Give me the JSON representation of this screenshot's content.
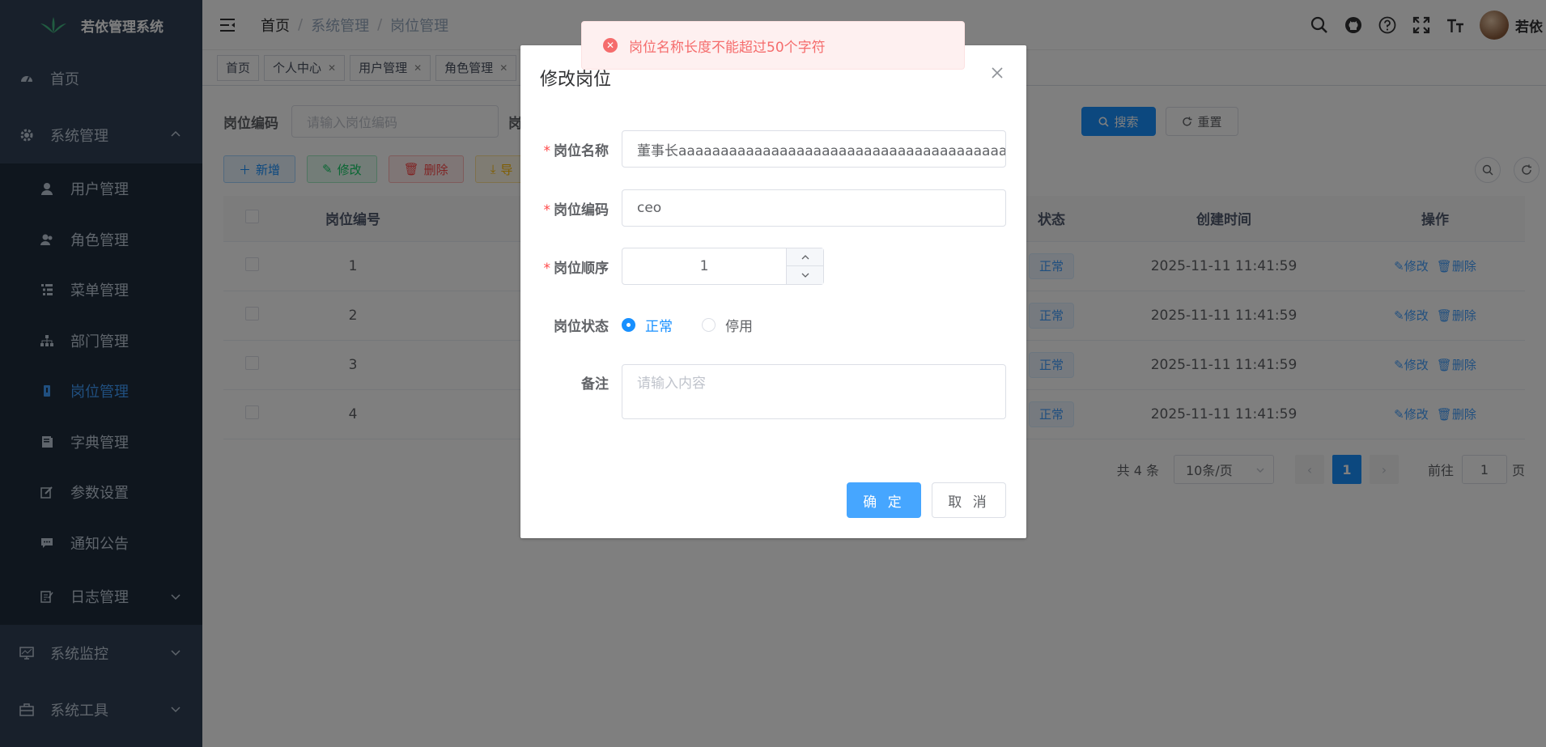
{
  "app": {
    "title": "若依管理系统"
  },
  "sidebar": {
    "items": [
      {
        "label": "首页",
        "icon": "dashboard-icon"
      },
      {
        "label": "系统管理",
        "icon": "gear-icon",
        "expanded": true
      }
    ],
    "submenu": [
      {
        "label": "用户管理",
        "icon": "user-icon"
      },
      {
        "label": "角色管理",
        "icon": "peoples-icon"
      },
      {
        "label": "菜单管理",
        "icon": "tree-table-icon"
      },
      {
        "label": "部门管理",
        "icon": "tree-icon"
      },
      {
        "label": "岗位管理",
        "icon": "post-icon",
        "active": true
      },
      {
        "label": "字典管理",
        "icon": "dict-icon"
      },
      {
        "label": "参数设置",
        "icon": "edit-icon"
      },
      {
        "label": "通知公告",
        "icon": "message-icon"
      },
      {
        "label": "日志管理",
        "icon": "log-icon"
      }
    ],
    "bottom": [
      {
        "label": "系统监控",
        "icon": "monitor-icon"
      },
      {
        "label": "系统工具",
        "icon": "tool-icon"
      }
    ]
  },
  "navbar": {
    "breadcrumb": [
      "首页",
      "系统管理",
      "岗位管理"
    ],
    "user_name": "若依"
  },
  "tags": [
    {
      "label": "首页",
      "closable": false
    },
    {
      "label": "个人中心",
      "closable": true
    },
    {
      "label": "用户管理",
      "closable": true
    },
    {
      "label": "角色管理",
      "closable": true
    }
  ],
  "search": {
    "code_label": "岗位编码",
    "code_placeholder": "请输入岗位编码",
    "name_label_partial": "岗",
    "search_btn": "搜索",
    "reset_btn": "重置"
  },
  "toolbar": {
    "add": "新增",
    "edit": "修改",
    "delete": "删除",
    "export_partial": "导"
  },
  "table": {
    "headers": {
      "id": "岗位编号",
      "status": "状态",
      "created": "创建时间",
      "ops": "操作"
    },
    "rows": [
      {
        "id": "1",
        "status": "正常",
        "created": "2025-11-11 11:41:59"
      },
      {
        "id": "2",
        "status": "正常",
        "created": "2025-11-11 11:41:59"
      },
      {
        "id": "3",
        "status": "正常",
        "created": "2025-11-11 11:41:59"
      },
      {
        "id": "4",
        "status": "正常",
        "created": "2025-11-11 11:41:59"
      }
    ],
    "op_edit": "修改",
    "op_delete": "删除"
  },
  "pagination": {
    "total": "共 4 条",
    "page_size": "10条/页",
    "current": "1",
    "goto_label": "前往",
    "goto_value": "1",
    "goto_suffix": "页"
  },
  "dialog": {
    "title": "修改岗位",
    "fields": {
      "name_label": "岗位名称",
      "name_value": "董事长aaaaaaaaaaaaaaaaaaaaaaaaaaaaaaaaaaaaaaa",
      "code_label": "岗位编码",
      "code_value": "ceo",
      "sort_label": "岗位顺序",
      "sort_value": "1",
      "status_label": "岗位状态",
      "status_options": [
        "正常",
        "停用"
      ],
      "status_selected": "正常",
      "remark_label": "备注",
      "remark_placeholder": "请输入内容"
    },
    "confirm": "确 定",
    "cancel": "取 消"
  },
  "toast": {
    "type": "error",
    "message": "岗位名称长度不能超过50个字符"
  },
  "colors": {
    "sidebar_bg": "#304156",
    "submenu_bg": "#1f2d3d",
    "primary": "#1890ff",
    "error": "#f56c6c"
  }
}
